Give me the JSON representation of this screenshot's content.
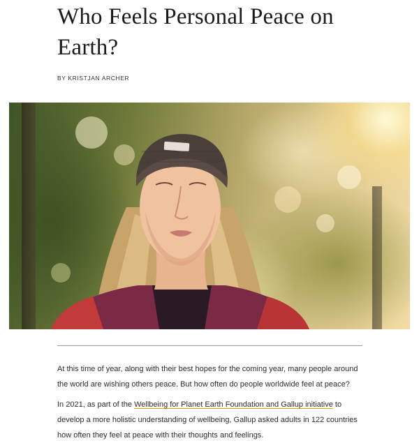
{
  "article": {
    "headline": "Who Feels Personal Peace on Earth?",
    "byline": "BY KRISTJAN ARCHER",
    "paragraph1": "At this time of year, along with their best hopes for the coming year, many people around the world are wishing others peace. But how often do people worldwide feel at peace?",
    "paragraph2": {
      "before": "In 2021, as part of the ",
      "link": "Wellbeing for Planet Earth Foundation and Gallup initiative",
      "after": " to develop a more holistic understanding of wellbeing, Gallup asked adults in 122 countries how often they feel at peace with their thoughts and feelings."
    }
  },
  "colors": {
    "link_underline": "#e0a100",
    "divider": "#9a9a9a"
  }
}
